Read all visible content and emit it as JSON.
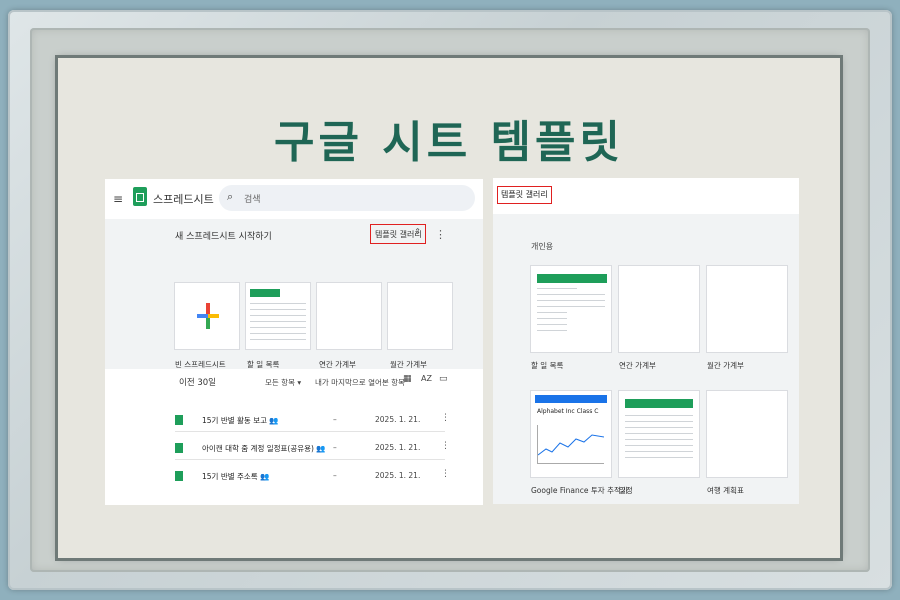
{
  "heading": "구글 시트 템플릿",
  "left_panel": {
    "hamburger": "≡",
    "app_name": "스프레드시트",
    "search": {
      "icon": "search-icon",
      "placeholder": "검색"
    },
    "start_label": "새 스프레드시트 시작하기",
    "gallery_button": "템플릿 갤러리",
    "gallery_arrow": "⇕",
    "more": "⋮",
    "templates": [
      {
        "label": "빈 스프레드시트"
      },
      {
        "label": "할 일 목록"
      },
      {
        "label": "연간 가계부"
      },
      {
        "label": "월간 가계부"
      }
    ],
    "recent": {
      "heading": "이전 30일",
      "owner_filter": "모든 항목 ▾",
      "sort": "내가 마지막으로 열어본 항목",
      "grid_icon": "grid-view-icon",
      "sort_icon": "sort-az-icon",
      "folder_icon": "folder-icon",
      "icons": {
        "grid": "▦",
        "az": "AZ",
        "folder": "▭"
      },
      "rows": [
        {
          "name": "15기 반별 활동 보고 👥",
          "owner": "–",
          "date": "2025. 1. 21."
        },
        {
          "name": "아이캔 대학 줌 계정 일정표(공유용) 👥",
          "owner": "–",
          "date": "2025. 1. 21."
        },
        {
          "name": "15기 반별 주소록 👥",
          "owner": "–",
          "date": "2025. 1. 21."
        }
      ]
    }
  },
  "right_panel": {
    "title": "템플릿 갤러리",
    "section": "개인용",
    "templates": [
      {
        "label": "할 일 목록"
      },
      {
        "label": "연간 가계부"
      },
      {
        "label": "월간 가계부"
      },
      {
        "label": "Google Finance 투자 추적기",
        "stock_name": "Alphabet Inc Class C"
      },
      {
        "label": "일정"
      },
      {
        "label": "여행 계획표"
      }
    ]
  },
  "colors": {
    "title": "#1f6655",
    "sheets_green": "#1e9e5a",
    "highlight": "#e02020"
  }
}
